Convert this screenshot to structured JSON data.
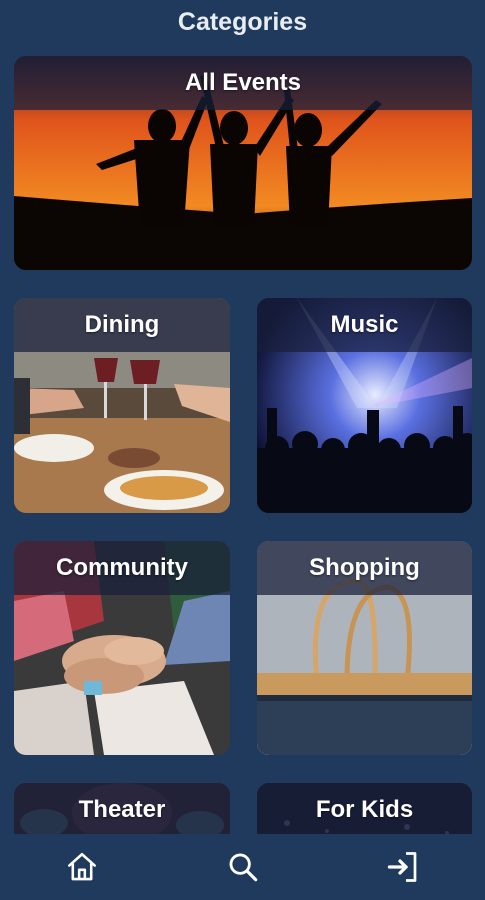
{
  "header": {
    "title": "Categories"
  },
  "categories": [
    {
      "label": "All Events"
    },
    {
      "label": "Dining"
    },
    {
      "label": "Music"
    },
    {
      "label": "Community"
    },
    {
      "label": "Shopping"
    },
    {
      "label": "Theater"
    },
    {
      "label": "For Kids"
    }
  ],
  "bottom_nav": [
    {
      "icon": "home-icon"
    },
    {
      "icon": "search-icon"
    },
    {
      "icon": "sign-in-icon"
    }
  ],
  "colors": {
    "background": "#1f3a5c",
    "label_band": "#181e3a",
    "text": "#ffffff"
  }
}
